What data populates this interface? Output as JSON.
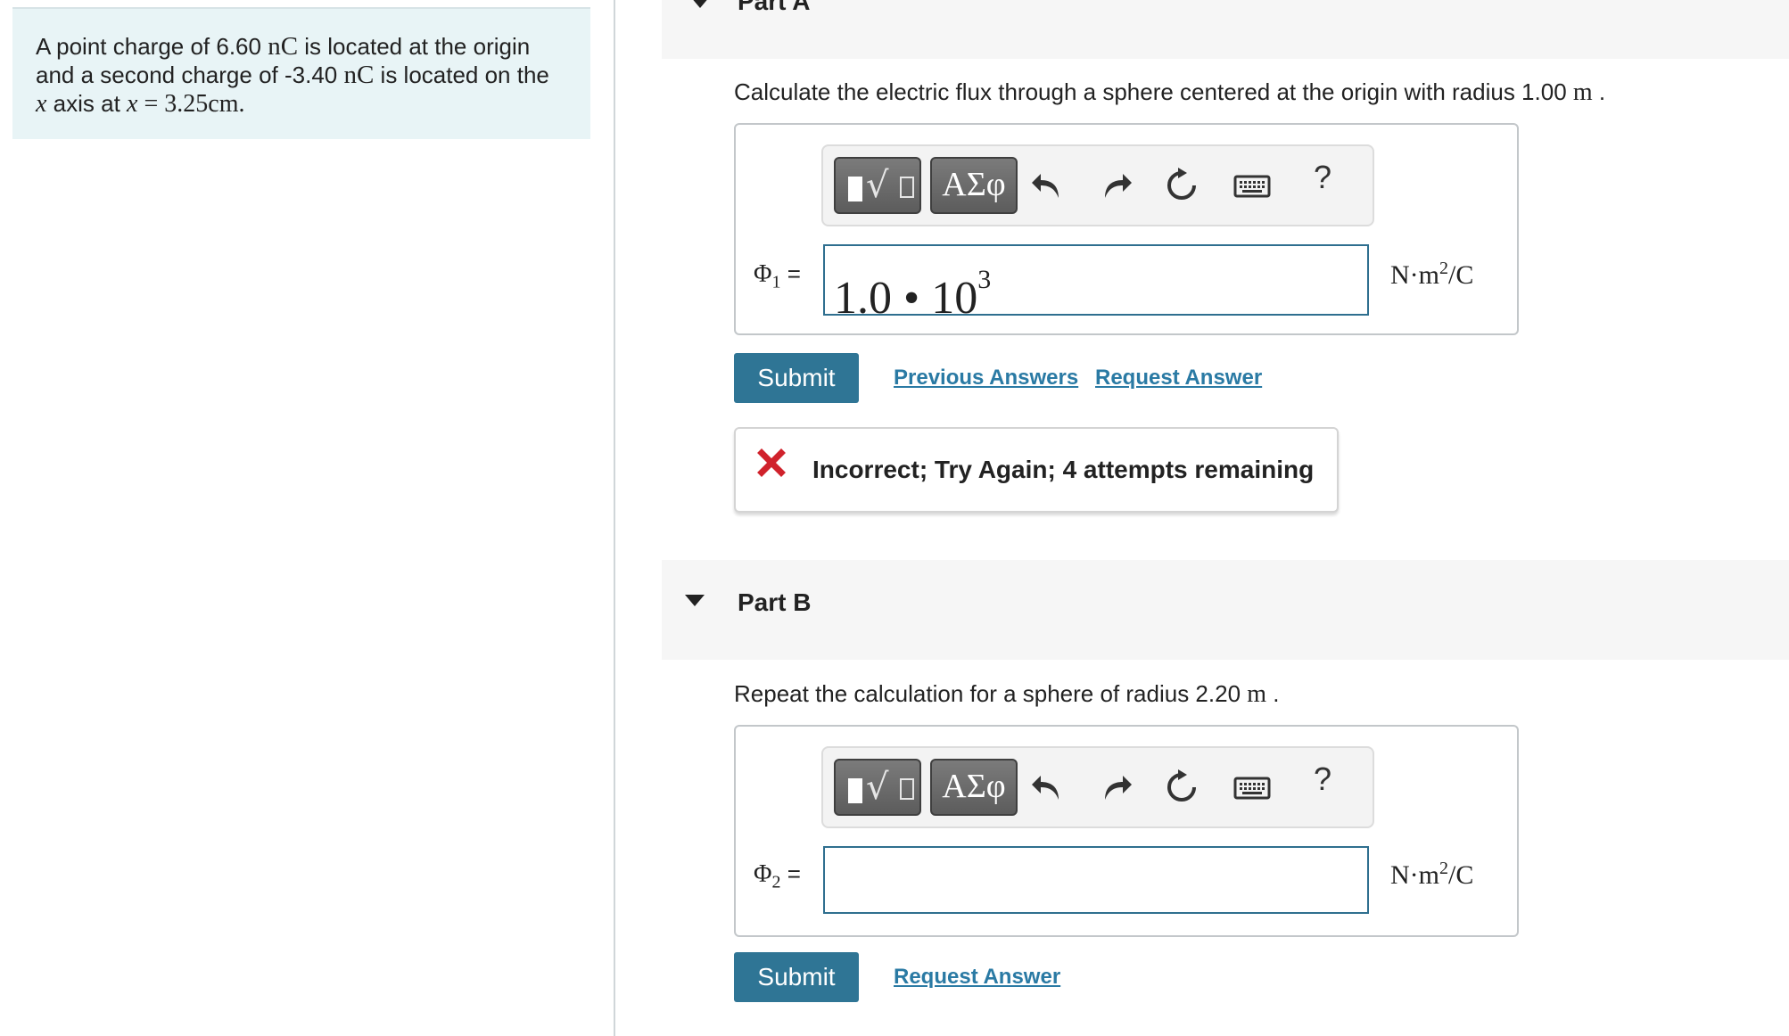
{
  "problem": {
    "text_1": "A point charge of 6.60 ",
    "unit_1": "nC",
    "text_2": " is located at the origin",
    "text_3": "and a second charge of -3.40 ",
    "unit_2": "nC",
    "text_4": " is located on the",
    "var_x": "x",
    "text_5": " axis at ",
    "var_x2": "x",
    "text_6": " = 3.25cm."
  },
  "part_a": {
    "title": "Part A",
    "question_text": "Calculate the electric flux through a sphere centered at the origin with radius 1.00 ",
    "question_unit": "m",
    "question_end": " .",
    "toolbar": {
      "greek_label": "ΑΣφ",
      "help_label": "?"
    },
    "label_symbol": "Φ",
    "label_sub": "1",
    "label_eq": " =",
    "input_mantissa": "1.0 • 10",
    "input_exponent": "3",
    "units_base": "N·m",
    "units_exp": "2",
    "units_tail": "/C",
    "submit_label": "Submit",
    "previous_answers_label": "Previous Answers",
    "request_answer_label": "Request Answer",
    "feedback_text": "Incorrect; Try Again; 4 attempts remaining"
  },
  "part_b": {
    "title": "Part B",
    "question_text": "Repeat the calculation for a sphere of radius 2.20 ",
    "question_unit": "m",
    "question_end": " .",
    "toolbar": {
      "greek_label": "ΑΣφ",
      "help_label": "?"
    },
    "label_symbol": "Φ",
    "label_sub": "2",
    "label_eq": " =",
    "input_value": "",
    "units_base": "N·m",
    "units_exp": "2",
    "units_tail": "/C",
    "submit_label": "Submit",
    "request_answer_label": "Request Answer"
  },
  "icons": [
    "templates-icon",
    "greek-icon",
    "undo-icon",
    "redo-icon",
    "reset-icon",
    "keyboard-icon",
    "help-icon",
    "caret-down-icon",
    "incorrect-x-icon"
  ],
  "colors": {
    "accent": "#2f7595",
    "link": "#2a7aa4",
    "error": "#d0222c",
    "problem_bg": "#e8f4f6"
  }
}
